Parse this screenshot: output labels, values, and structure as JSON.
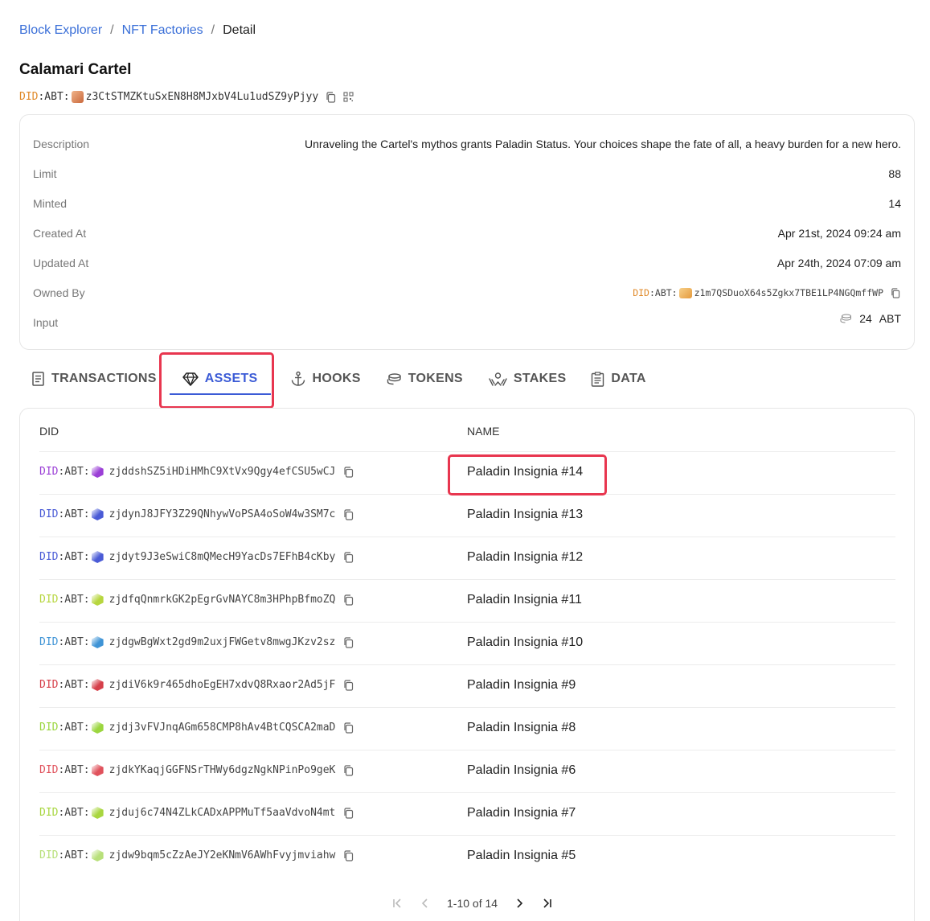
{
  "breadcrumb": {
    "items": [
      "Block Explorer",
      "NFT Factories"
    ],
    "current": "Detail",
    "separator": "/"
  },
  "title": "Calamari Cartel",
  "factory": {
    "did_prefix_a": "DID",
    "did_prefix_b": ":ABT:",
    "address": "z3CtSTMZKtuSxEN8H8MJxbV4Lu1udSZ9yPjyy"
  },
  "info": {
    "description_label": "Description",
    "description": "Unraveling the Cartel's mythos grants Paladin Status. Your choices shape the fate of all, a heavy burden for a new hero.",
    "limit_label": "Limit",
    "limit": "88",
    "minted_label": "Minted",
    "minted": "14",
    "created_label": "Created At",
    "created": "Apr 21st, 2024 09:24 am",
    "updated_label": "Updated At",
    "updated": "Apr 24th, 2024 07:09 am",
    "owned_label": "Owned By",
    "owner_prefix_a": "DID",
    "owner_prefix_b": ":ABT:",
    "owner": "z1m7QSDuoX64s5Zgkx7TBE1LP4NGQmffWP",
    "input_label": "Input",
    "input_amount": "24",
    "input_unit": "ABT"
  },
  "tabs": [
    {
      "label": "TRANSACTIONS",
      "icon": "receipt-icon"
    },
    {
      "label": "ASSETS",
      "icon": "diamond-icon",
      "active": true
    },
    {
      "label": "HOOKS",
      "icon": "anchor-icon"
    },
    {
      "label": "TOKENS",
      "icon": "coins-icon"
    },
    {
      "label": "STAKES",
      "icon": "stake-hands-icon"
    },
    {
      "label": "DATA",
      "icon": "clipboard-icon"
    }
  ],
  "table": {
    "headers": {
      "did": "DID",
      "name": "NAME"
    },
    "rows": [
      {
        "prefix_a": "DID",
        "prefix_b": ":ABT:",
        "address": "zjddshSZ5iHDiHMhC9XtVx9Qgy4efCSU5wCJ",
        "name": "Paladin Insignia #14",
        "color": "#9b3fd6"
      },
      {
        "prefix_a": "DID",
        "prefix_b": ":ABT:",
        "address": "zjdynJ8JFY3Z29QNhywVoPSA4oSoW4w3SM7c",
        "name": "Paladin Insignia #13",
        "color": "#4a5bd6"
      },
      {
        "prefix_a": "DID",
        "prefix_b": ":ABT:",
        "address": "zjdyt9J3eSwiC8mQMecH9YacDs7EFhB4cKby",
        "name": "Paladin Insignia #12",
        "color": "#4a5bd6"
      },
      {
        "prefix_a": "DID",
        "prefix_b": ":ABT:",
        "address": "zjdfqQnmrkGK2pEgrGvNAYC8m3HPhpBfmoZQ",
        "name": "Paladin Insignia #11",
        "color": "#b7d63f"
      },
      {
        "prefix_a": "DID",
        "prefix_b": ":ABT:",
        "address": "zjdgwBgWxt2gd9m2uxjFWGetv8mwgJKzv2sz",
        "name": "Paladin Insignia #10",
        "color": "#3f94d6"
      },
      {
        "prefix_a": "DID",
        "prefix_b": ":ABT:",
        "address": "zjdiV6k9r465dhoEgEH7xdvQ8Rxaor2Ad5jF",
        "name": "Paladin Insignia #9",
        "color": "#d63f4a"
      },
      {
        "prefix_a": "DID",
        "prefix_b": ":ABT:",
        "address": "zjdj3vFVJnqAGm658CMP8hAv4BtCQSCA2maD",
        "name": "Paladin Insignia #8",
        "color": "#9bd63f"
      },
      {
        "prefix_a": "DID",
        "prefix_b": ":ABT:",
        "address": "zjdkYKaqjGGFNSrTHWy6dgzNgkNPinPo9geK",
        "name": "Paladin Insignia #6",
        "color": "#e0525c"
      },
      {
        "prefix_a": "DID",
        "prefix_b": ":ABT:",
        "address": "zjduj6c74N4ZLkCADxAPPMuTf5aaVdvoN4mt",
        "name": "Paladin Insignia #7",
        "color": "#a8d63f"
      },
      {
        "prefix_a": "DID",
        "prefix_b": ":ABT:",
        "address": "zjdw9bqm5cZzAeJY2eKNmV6AWhFvyjmviahw",
        "name": "Paladin Insignia #5",
        "color": "#b8e07a"
      }
    ]
  },
  "pagination": {
    "range": "1-10 of 14"
  },
  "colors": {
    "link": "#3a6fd8",
    "active_tab": "#3b5bd6",
    "highlight": "#e8364f",
    "did_prefix_factory": "#e08a2a"
  }
}
